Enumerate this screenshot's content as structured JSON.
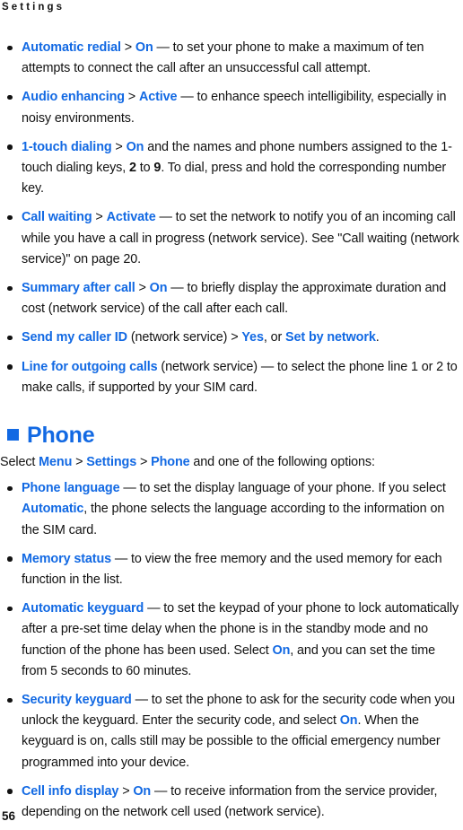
{
  "page": {
    "running_head": "Settings",
    "folio": "56",
    "accent_color": "#1269E3",
    "text_color": "#121212",
    "background_color": "#FFFFFF"
  },
  "call_settings_bullets": [
    {
      "id": "automatic-redial",
      "parts": [
        {
          "t": "Automatic redial",
          "s": "key"
        },
        {
          "t": " > ",
          "s": "plain"
        },
        {
          "t": "On",
          "s": "key"
        },
        {
          "t": " — to set your phone to make a maximum of ten attempts to connect the call after an unsuccessful call attempt.",
          "s": "plain"
        }
      ]
    },
    {
      "id": "audio-enhancing",
      "parts": [
        {
          "t": "Audio enhancing",
          "s": "key"
        },
        {
          "t": " > ",
          "s": "plain"
        },
        {
          "t": "Active",
          "s": "key"
        },
        {
          "t": " — to enhance speech intelligibility, especially in noisy environments.",
          "s": "plain"
        }
      ]
    },
    {
      "id": "one-touch-dialing",
      "parts": [
        {
          "t": "1-touch dialing",
          "s": "key"
        },
        {
          "t": " > ",
          "s": "plain"
        },
        {
          "t": "On",
          "s": "key"
        },
        {
          "t": " and the names and phone numbers assigned to the 1-touch dialing keys, ",
          "s": "plain"
        },
        {
          "t": "2",
          "s": "bold"
        },
        {
          "t": " to ",
          "s": "plain"
        },
        {
          "t": "9",
          "s": "bold"
        },
        {
          "t": ". To dial, press and hold the corresponding number key.",
          "s": "plain"
        }
      ]
    },
    {
      "id": "call-waiting",
      "parts": [
        {
          "t": "Call waiting",
          "s": "key"
        },
        {
          "t": " > ",
          "s": "plain"
        },
        {
          "t": "Activate",
          "s": "key"
        },
        {
          "t": " — to set the network to notify you of an incoming call while you have a call in progress (network service). See \"Call waiting (network service)\" on page 20.",
          "s": "plain"
        }
      ]
    },
    {
      "id": "summary-after-call",
      "parts": [
        {
          "t": "Summary after call",
          "s": "key"
        },
        {
          "t": " > ",
          "s": "plain"
        },
        {
          "t": "On",
          "s": "key"
        },
        {
          "t": " — to briefly display the approximate duration and cost (network service) of the call after each call.",
          "s": "plain"
        }
      ]
    },
    {
      "id": "send-my-caller-id",
      "parts": [
        {
          "t": "Send my caller ID",
          "s": "key"
        },
        {
          "t": " (network service) > ",
          "s": "plain"
        },
        {
          "t": "Yes",
          "s": "key"
        },
        {
          "t": ", or ",
          "s": "plain"
        },
        {
          "t": "Set by network",
          "s": "key"
        },
        {
          "t": ".",
          "s": "plain"
        }
      ]
    },
    {
      "id": "line-for-outgoing-calls",
      "parts": [
        {
          "t": "Line for outgoing calls",
          "s": "key"
        },
        {
          "t": " (network service) — to select the phone line 1 or 2 to make calls, if supported by your SIM card.",
          "s": "plain"
        }
      ]
    }
  ],
  "phone_section": {
    "heading": "Phone",
    "lead_parts": [
      {
        "t": "Select ",
        "s": "plain"
      },
      {
        "t": "Menu",
        "s": "key"
      },
      {
        "t": " > ",
        "s": "plain"
      },
      {
        "t": "Settings",
        "s": "key"
      },
      {
        "t": " > ",
        "s": "plain"
      },
      {
        "t": "Phone",
        "s": "key"
      },
      {
        "t": " and one of the following options:",
        "s": "plain"
      }
    ],
    "bullets": [
      {
        "id": "phone-language",
        "parts": [
          {
            "t": "Phone language",
            "s": "key"
          },
          {
            "t": " — to set the display language of your phone. If you select ",
            "s": "plain"
          },
          {
            "t": "Automatic",
            "s": "key"
          },
          {
            "t": ", the phone selects the language according to the information on the SIM card.",
            "s": "plain"
          }
        ]
      },
      {
        "id": "memory-status",
        "parts": [
          {
            "t": "Memory status",
            "s": "key"
          },
          {
            "t": " — to view the free memory and the used memory for each function in the list.",
            "s": "plain"
          }
        ]
      },
      {
        "id": "automatic-keyguard",
        "parts": [
          {
            "t": "Automatic keyguard",
            "s": "key"
          },
          {
            "t": " — to set the keypad of your phone to lock automatically after a pre-set time delay when the phone is in the standby mode and no function of the phone has been used. Select ",
            "s": "plain"
          },
          {
            "t": "On",
            "s": "key"
          },
          {
            "t": ", and you can set the time from 5 seconds to 60 minutes.",
            "s": "plain"
          }
        ]
      },
      {
        "id": "security-keyguard",
        "parts": [
          {
            "t": "Security keyguard",
            "s": "key"
          },
          {
            "t": " — to set the phone to ask for the security code when you unlock the keyguard. Enter the security code, and select ",
            "s": "plain"
          },
          {
            "t": "On",
            "s": "key"
          },
          {
            "t": ". When the keyguard is on, calls still may be possible to the official emergency number programmed into your device.",
            "s": "plain"
          }
        ]
      },
      {
        "id": "cell-info-display",
        "parts": [
          {
            "t": "Cell info display",
            "s": "key"
          },
          {
            "t": " > ",
            "s": "plain"
          },
          {
            "t": "On",
            "s": "key"
          },
          {
            "t": " — to receive information from the service provider, depending on the network cell used (network service).",
            "s": "plain"
          }
        ]
      }
    ]
  }
}
